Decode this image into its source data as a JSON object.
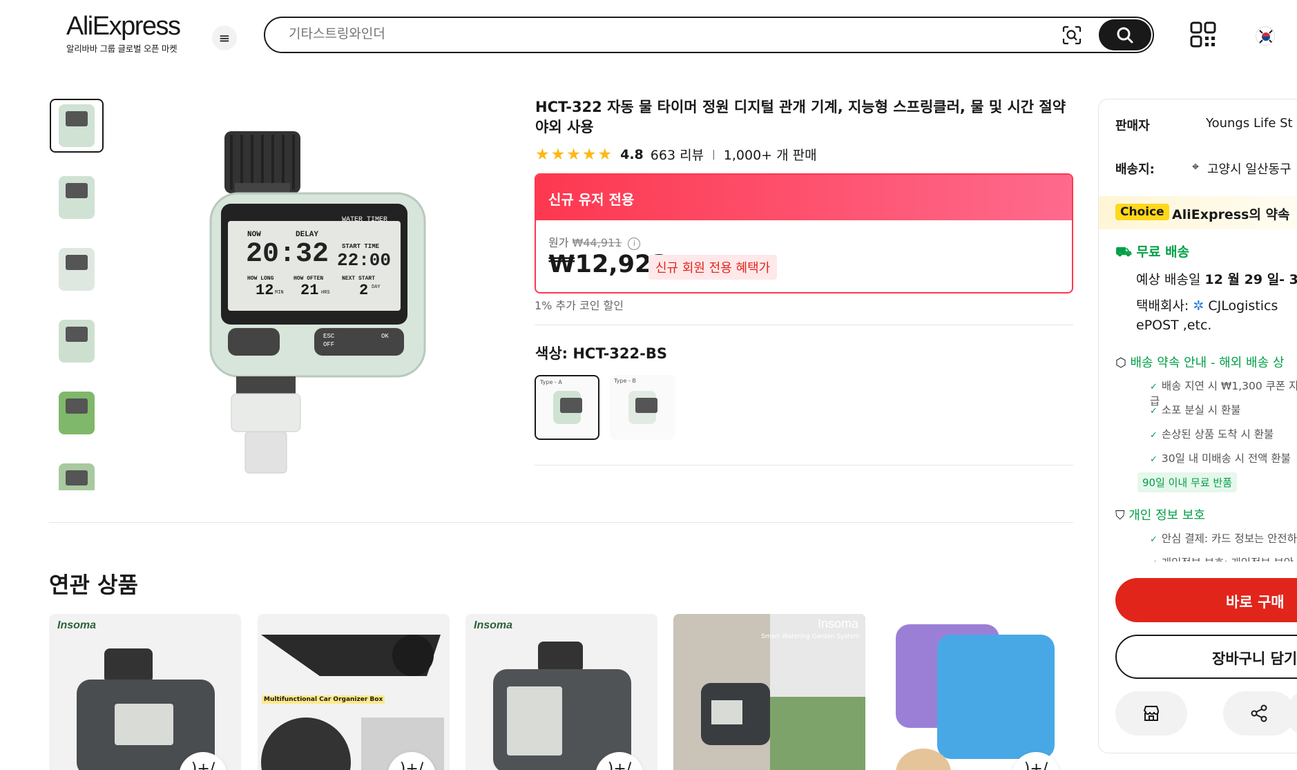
{
  "header": {
    "logo_text": "AliExpress",
    "logo_sub": "알리바바 그룹 글로벌 오픈 마켓",
    "search_placeholder": "기타스트링와인더"
  },
  "product": {
    "title": "HCT-322 자동 물 타이머 정원 디지털 관개 기계, 지능형 스프링클러, 물 및 시간 절약 야외 사용",
    "rating": "4.8",
    "rating_stars": 5,
    "reviews": "663 리뷰",
    "sold": "1,000+ 개 판매",
    "promo_header": "신규 유저 전용",
    "original_label": "원가",
    "original_price": "₩44,911",
    "price": "₩12,923",
    "price_tag": "신규 회원 전용 혜택가",
    "coin_note": "1% 추가 코인 할인",
    "color_label": "색상: HCT-322-BS",
    "swatches": [
      "Type - A",
      "Type - B"
    ]
  },
  "device": {
    "label_water_timer": "WATER TIMER",
    "label_now": "NOW",
    "label_delay": "DELAY",
    "time_now": "20:32",
    "label_start": "START TIME",
    "time_start": "22:00",
    "label_how_long": "HOW LONG",
    "val_how_long": "12",
    "unit_how_long": "MIN",
    "label_how_often": "HOW OFTEN",
    "val_how_often": "21",
    "unit_how_often": "HRS",
    "label_next": "NEXT START",
    "val_next": "2",
    "unit_next": "DAY",
    "btn_esc": "ESC",
    "btn_off": "OFF",
    "btn_ok": "OK"
  },
  "panel": {
    "seller_label": "판매자",
    "seller_value": "Youngs Life St",
    "ship_label": "배송지:",
    "ship_value": "고양시 일산동구",
    "choice_tag": "Choice",
    "choice_text": "AliExpress의 약속",
    "free_ship": "무료 배송",
    "delivery_date_prefix": "예상 배송일",
    "delivery_date": "12 월 29 일- 3",
    "carrier_label": "택배회사:",
    "carrier_value": "CJLogistics",
    "carrier_more": "ePOST ,etc.",
    "promise_title": "배송 약속 안내 - 해외 배송 상",
    "promise_items": [
      "배송 지연 시 ₩1,300 쿠폰 지급",
      "소포 분실 시 환불",
      "손상된 상품 도착 시 환불",
      "30일 내 미배송 시 전액 환불"
    ],
    "return_badge": "90일 이내 무료 반품",
    "privacy_title": "개인 정보 보호",
    "privacy_items": [
      "안심 결제: 카드 정보는 안전하",
      "개인정보 보호: 개인정보 보안"
    ],
    "buy_now": "바로 구매",
    "add_cart": "장바구니 담기"
  },
  "related": {
    "title": "연관 상품",
    "cards": [
      {
        "brand": "Insoma",
        "caption": ""
      },
      {
        "brand": "",
        "caption": "Multifunctional Car Organizer Box"
      },
      {
        "brand": "Insoma",
        "caption": ""
      },
      {
        "brand": "Insoma",
        "caption": "Smart Watering Garden System"
      },
      {
        "brand": "",
        "caption": ""
      }
    ],
    "plus_label": ")+/"
  },
  "colors": {
    "accent_red": "#e1251b",
    "promo_pink": "#fd384f",
    "star": "#fdb813",
    "green": "#00a046",
    "choice_yellow": "#ffd81a"
  }
}
